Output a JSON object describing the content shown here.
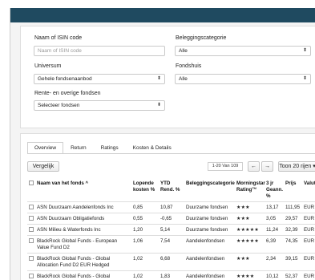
{
  "filters": {
    "isin": {
      "label": "Naam of ISIN code",
      "placeholder": "Naam of ISIN code",
      "value": ""
    },
    "category": {
      "label": "Beleggingscategorie",
      "value": "Alle"
    },
    "universe": {
      "label": "Universum",
      "value": "Gehele fondsenaanbod"
    },
    "fund_house": {
      "label": "Fondshuis",
      "value": "Alle"
    },
    "rente": {
      "label": "Rente- en overige fondsen",
      "value": "Selecteer fondsen"
    },
    "select_arrow": "⬍"
  },
  "tabs": [
    "Overview",
    "Return",
    "Ratings",
    "Kosten & Details"
  ],
  "toolbar": {
    "compare_label": "Vergelijk",
    "pager_text": "1-20 Van 109",
    "prev_arrow": "←",
    "next_arrow": "→",
    "rows_label": "Toon 20 rijen ▾"
  },
  "table": {
    "headers": {
      "name": "Naam van het fonds ^",
      "costs": "Lopende kosten %",
      "ytd": "YTD Rend. %",
      "category": "Beleggingscategorie",
      "rating": "Morningstar Rating™",
      "y3": "3 jr Geann. %",
      "price": "Prijs",
      "currency": "Valuta"
    },
    "rows": [
      {
        "name": "ASN Duurzaam Aandelenfonds Inc",
        "costs": "0,85",
        "ytd": "10,87",
        "category": "Duurzame fondsen",
        "stars": "★★★",
        "y3": "13,17",
        "price": "111,95",
        "currency": "EUR"
      },
      {
        "name": "ASN Duurzaam Obligatiefonds",
        "costs": "0,55",
        "ytd": "-0,65",
        "category": "Duurzame fondsen",
        "stars": "★★★",
        "y3": "3,05",
        "price": "29,57",
        "currency": "EUR"
      },
      {
        "name": "ASN Milieu & Waterfonds Inc",
        "costs": "1,20",
        "ytd": "5,14",
        "category": "Duurzame fondsen",
        "stars": "★★★★★",
        "y3": "11,24",
        "price": "32,39",
        "currency": "EUR"
      },
      {
        "name": "BlackRock Global Funds - European Value Fund D2",
        "costs": "1,06",
        "ytd": "7,54",
        "category": "Aandelenfondsen",
        "stars": "★★★★★",
        "y3": "6,39",
        "price": "74,35",
        "currency": "EUR"
      },
      {
        "name": "BlackRock Global Funds - Global Allocation Fund D2 EUR Hedged",
        "costs": "1,02",
        "ytd": "6,68",
        "category": "Aandelenfondsen",
        "stars": "★★★",
        "y3": "2,34",
        "price": "39,15",
        "currency": "EUR"
      },
      {
        "name": "BlackRock Global Funds - Global",
        "costs": "1,02",
        "ytd": "1,83",
        "category": "Aandelenfondsen",
        "stars": "★★★★",
        "y3": "10,12",
        "price": "52,37",
        "currency": "EUR"
      }
    ]
  }
}
